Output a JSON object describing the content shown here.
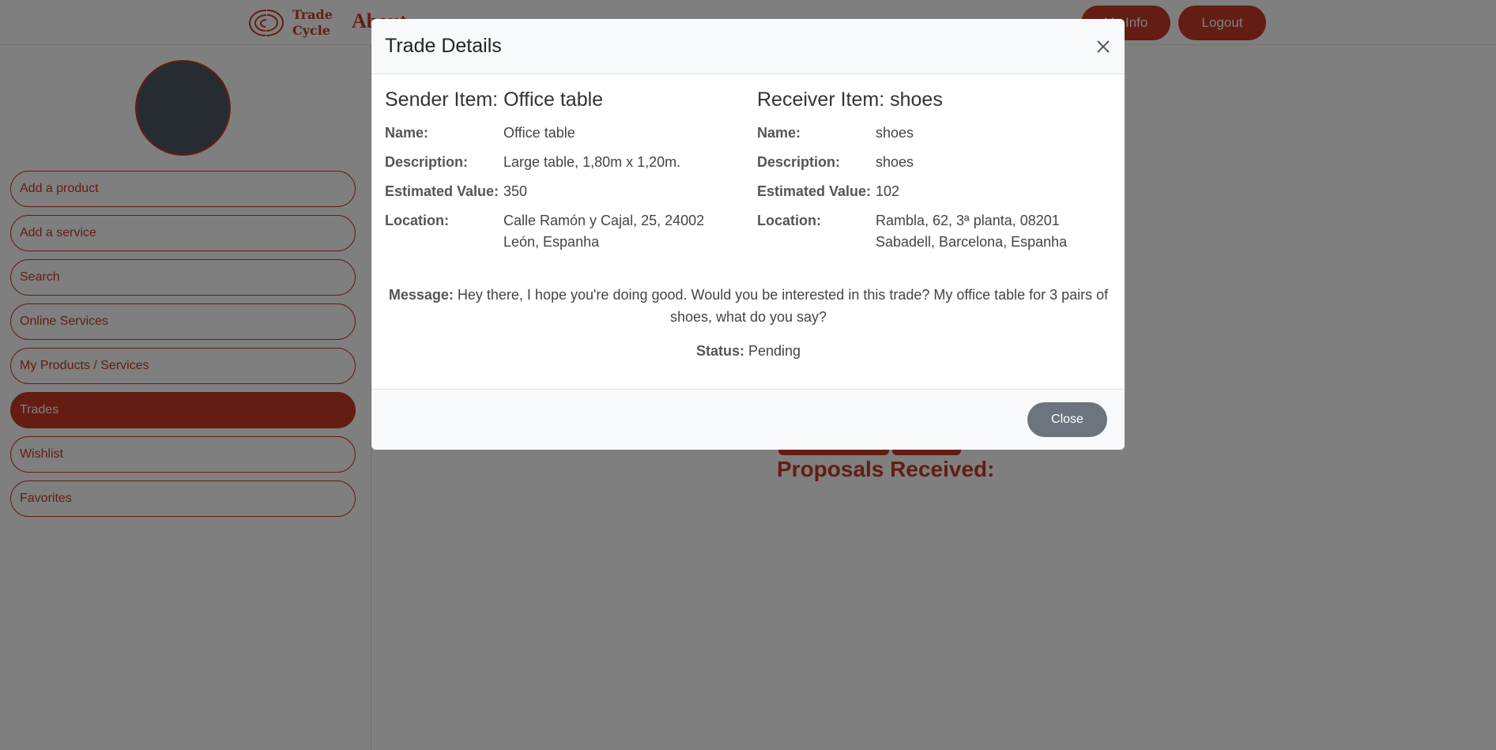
{
  "header": {
    "logo_line1": "Trade",
    "logo_line2": "Cycle",
    "nav_about": "About",
    "my_info_label": "My Info",
    "logout_label": "Logout"
  },
  "sidebar": {
    "items": [
      {
        "label": "Add a product",
        "active": false
      },
      {
        "label": "Add a service",
        "active": false
      },
      {
        "label": "Search",
        "active": false
      },
      {
        "label": "Online Services",
        "active": false
      },
      {
        "label": "My Products / Services",
        "active": false
      },
      {
        "label": "Trades",
        "active": true
      },
      {
        "label": "Wishlist",
        "active": false
      },
      {
        "label": "Favorites",
        "active": false
      }
    ]
  },
  "main": {
    "proposals_heading": "Proposals Received:"
  },
  "modal": {
    "title": "Trade Details",
    "sender": {
      "heading": "Sender Item: Office table",
      "name_label": "Name:",
      "name": "Office table",
      "description_label": "Description:",
      "description": "Large table, 1,80m x 1,20m.",
      "value_label": "Estimated Value:",
      "value": "350",
      "location_label": "Location:",
      "location": "Calle Ramón y Cajal, 25, 24002 León, Espanha"
    },
    "receiver": {
      "heading": "Receiver Item: shoes",
      "name_label": "Name:",
      "name": "shoes",
      "description_label": "Description:",
      "description": "shoes",
      "value_label": "Estimated Value:",
      "value": "102",
      "location_label": "Location:",
      "location": "Rambla, 62, 3ª planta, 08201 Sabadell, Barcelona, Espanha"
    },
    "message_label": "Message:",
    "message": "Hey there, I hope you're doing good. Would you be interested in this trade? My office table for 3 pairs of shoes, what do you say?",
    "status_label": "Status:",
    "status": "Pending",
    "close_label": "Close"
  },
  "colors": {
    "brand": "#c73a26",
    "avatar": "#4f5866",
    "close_button": "#6c757d"
  }
}
